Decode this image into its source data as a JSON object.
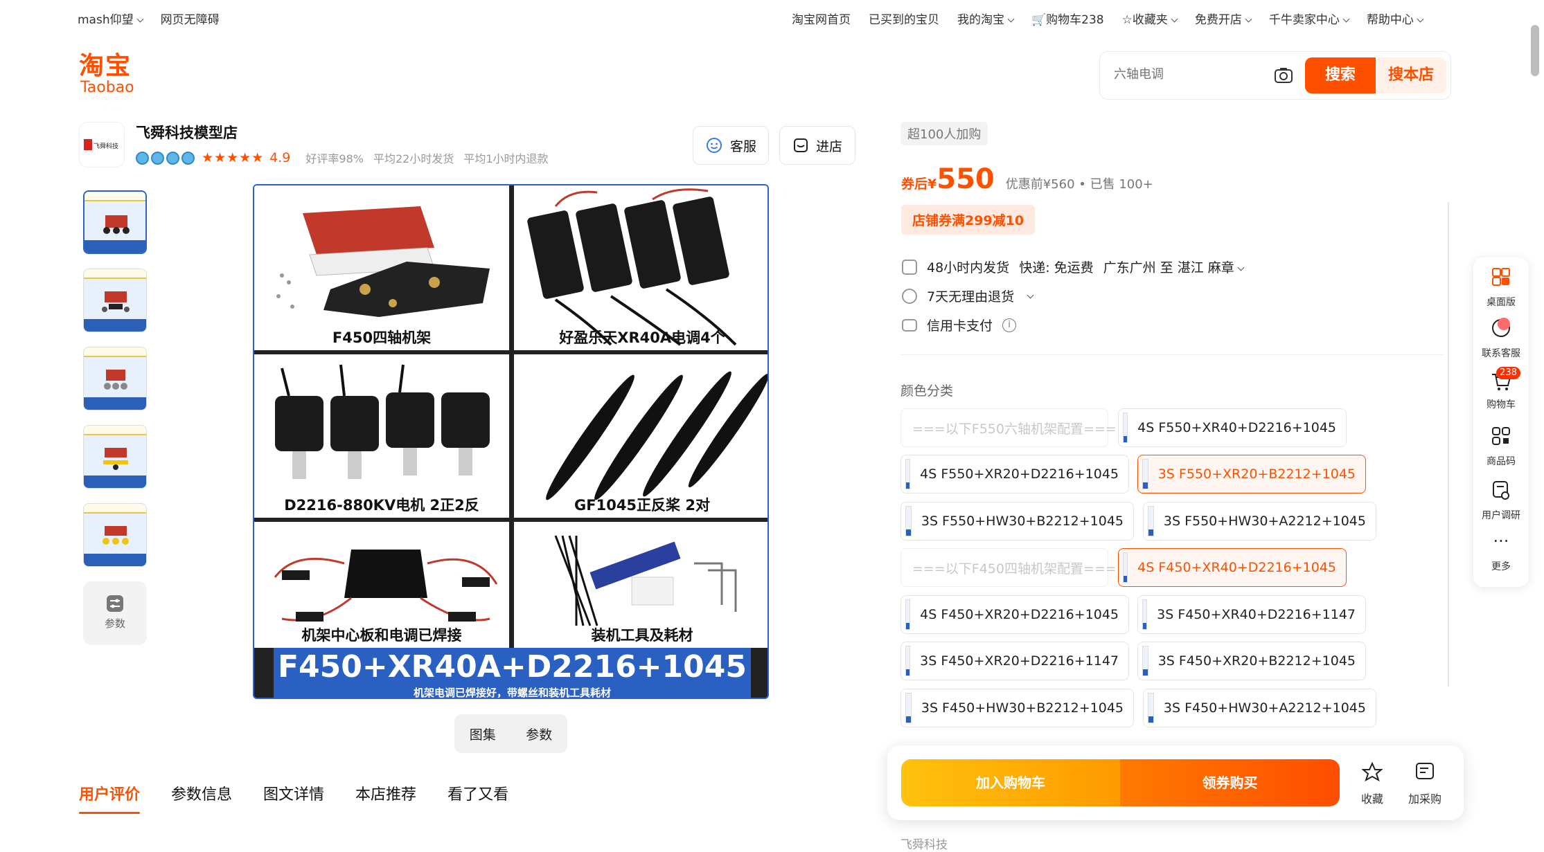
{
  "topbar": {
    "user": "mash仰望",
    "accessibility": "网页无障碍",
    "right": [
      {
        "label": "淘宝网首页"
      },
      {
        "label": "已买到的宝贝"
      },
      {
        "label": "我的淘宝"
      },
      {
        "label": "购物车238"
      },
      {
        "label": "收藏夹"
      },
      {
        "label": "免费开店"
      },
      {
        "label": "千牛卖家中心"
      },
      {
        "label": "帮助中心"
      }
    ]
  },
  "logo": {
    "cn": "淘宝",
    "en": "Taobao"
  },
  "search": {
    "placeholder": "六轴电调",
    "search_btn": "搜索",
    "shop_search_btn": "搜本店"
  },
  "shop": {
    "name": "飞舜科技模型店",
    "logo_text": "飞舜科技",
    "rating": "4.9",
    "good_rate": "好评率98%",
    "ship_time": "平均22小时发货",
    "refund_time": "平均1小时内退款",
    "service_btn": "客服",
    "enter_btn": "进店"
  },
  "thumbs_param": "参数",
  "main_image": {
    "cells": [
      "F450四轴机架",
      "好盈乐天XR40A电调4个",
      "D2216-880KV电机 2正2反",
      "GF1045正反桨 2对",
      "机架中心板和电调已焊接",
      "装机工具及耗材"
    ],
    "banner_title": "F450+XR40A+D2216+1045",
    "banner_sub": "机架电调已焊接好，带螺丝和装机工具耗材"
  },
  "image_toggle": {
    "gallery": "图集",
    "params": "参数"
  },
  "tabs": [
    "用户评价",
    "参数信息",
    "图文详情",
    "本店推荐",
    "看了又看"
  ],
  "product": {
    "sold_tag": "超100人加购",
    "price_label": "券后¥",
    "price": "550",
    "orig": "优惠前¥560 • 已售 100+",
    "coupon": "店铺券满299减10",
    "delivery": "48小时内发货",
    "shipping": "快递: 免运费",
    "route": "广东广州 至 湛江 麻章",
    "returns": "7天无理由退货",
    "payment": "信用卡支付"
  },
  "color_title": "颜色分类",
  "skus": [
    {
      "label": "===以下F550六轴机架配置===",
      "state": "disabled"
    },
    {
      "label": "4S F550+XR40+D2216+1045",
      "state": "normal"
    },
    {
      "label": "4S F550+XR20+D2216+1045",
      "state": "normal"
    },
    {
      "label": "3S F550+XR20+B2212+1045",
      "state": "selected"
    },
    {
      "label": "3S F550+HW30+B2212+1045",
      "state": "normal"
    },
    {
      "label": "3S F550+HW30+A2212+1045",
      "state": "normal"
    },
    {
      "label": "===以下F450四轴机架配置===",
      "state": "disabled"
    },
    {
      "label": "4S F450+XR40+D2216+1045",
      "state": "selected"
    },
    {
      "label": "4S F450+XR20+D2216+1045",
      "state": "normal"
    },
    {
      "label": "3S F450+XR40+D2216+1147",
      "state": "normal"
    },
    {
      "label": "3S F450+XR20+D2216+1147",
      "state": "normal"
    },
    {
      "label": "3S F450+XR20+B2212+1045",
      "state": "normal"
    },
    {
      "label": "3S F450+HW30+B2212+1045",
      "state": "normal"
    },
    {
      "label": "3S F450+HW30+A2212+1045",
      "state": "normal"
    }
  ],
  "buybar": {
    "add_cart": "加入购物车",
    "buy": "领券购买",
    "fav": "收藏",
    "add_purchase": "加采购"
  },
  "side_float": [
    {
      "label": "桌面版"
    },
    {
      "label": "联系客服"
    },
    {
      "label": "购物车",
      "badge": "238"
    },
    {
      "label": "商品码"
    },
    {
      "label": "用户调研"
    },
    {
      "label": "更多"
    }
  ],
  "bottom_text": "飞舜科技",
  "colors": {
    "accent": "#ff5000",
    "banner": "#2960c1"
  }
}
